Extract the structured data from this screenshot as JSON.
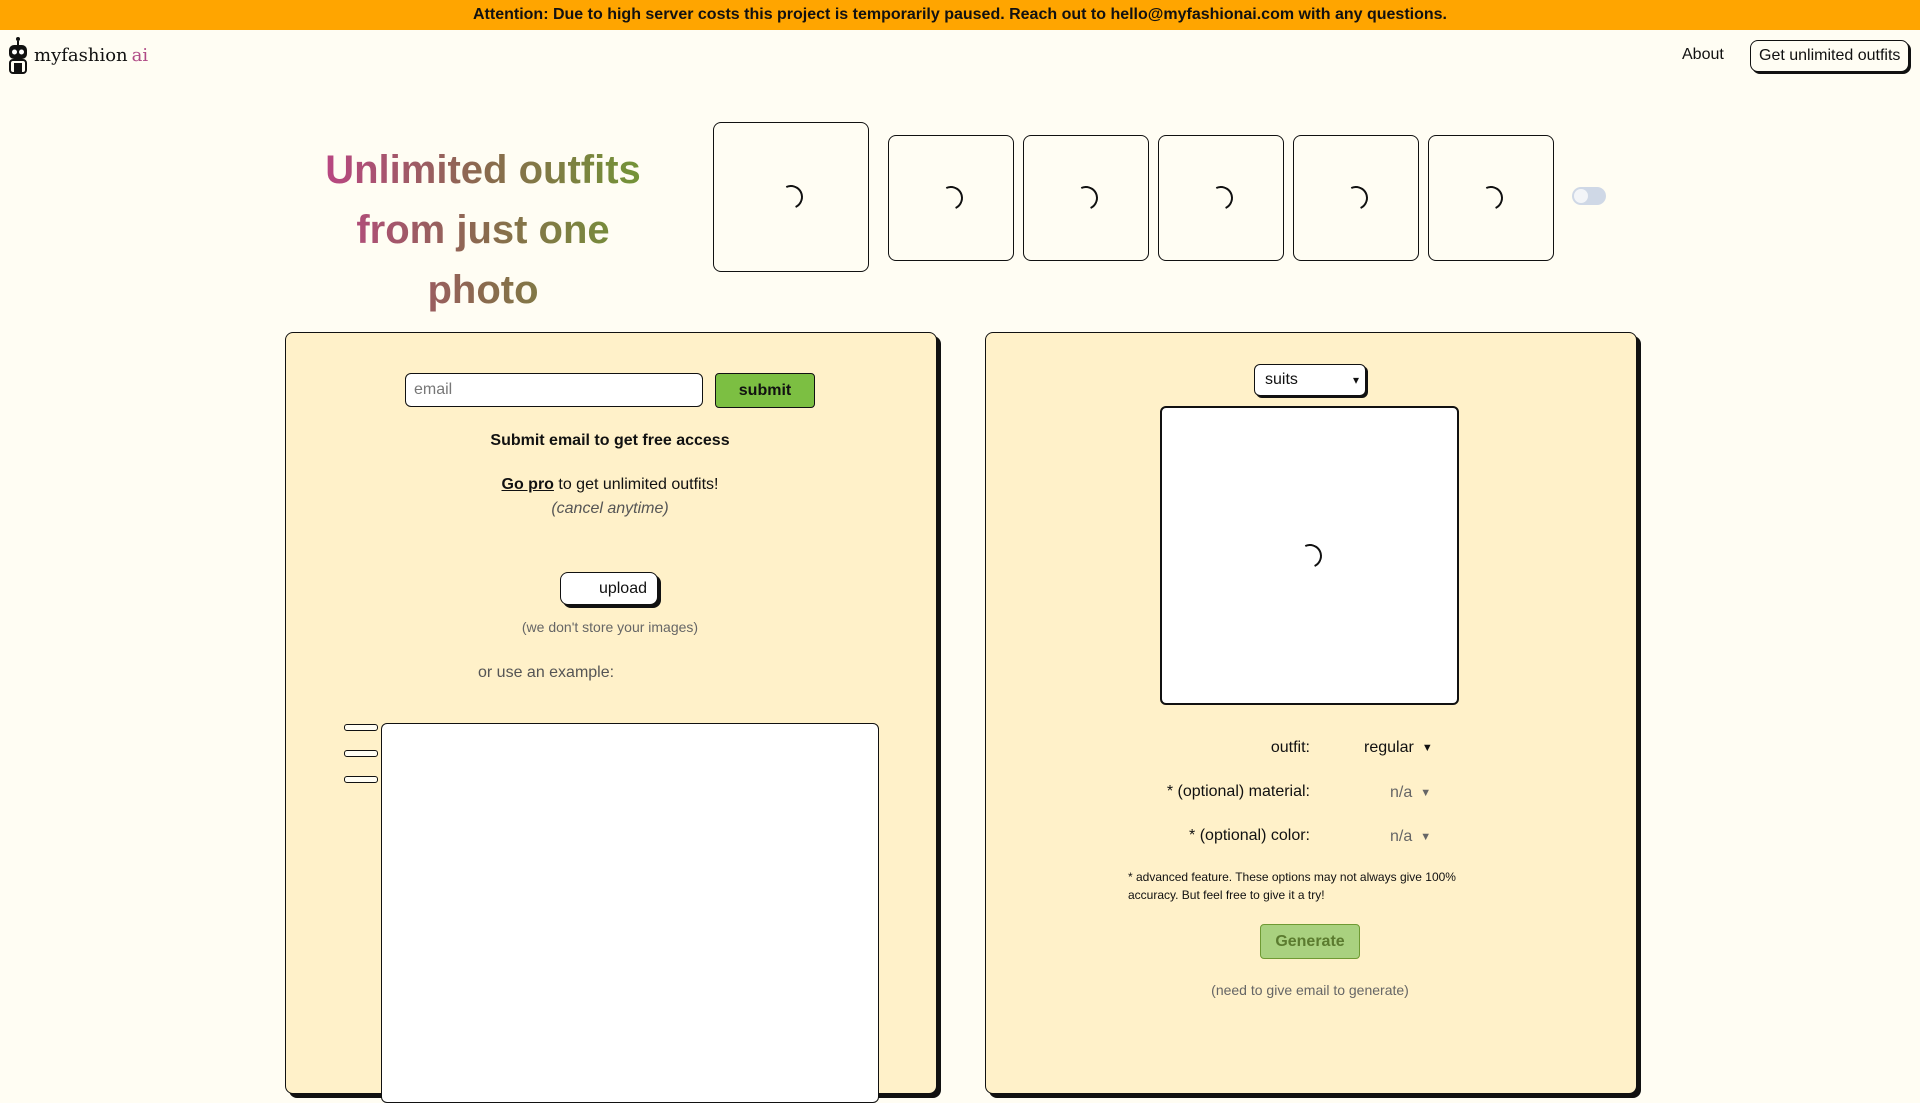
{
  "banner": {
    "text": "Attention: Due to high server costs this project is temporarily paused. Reach out to hello@myfashionai.com with any questions."
  },
  "header": {
    "logo_text": "myfashion",
    "logo_ai": "ai",
    "about_label": "About",
    "cta_label": "Get unlimited outfits"
  },
  "hero": {
    "line1": "Unlimited outfits",
    "line2": "from just one photo"
  },
  "left_panel": {
    "email_placeholder": "email",
    "submit_label": "submit",
    "email_prompt": "Submit email to get free access",
    "go_pro_link": "Go pro",
    "go_pro_rest": "to get unlimited outfits!",
    "cancel_note": "(cancel anytime)",
    "upload_label": "upload",
    "upload_note": "(we don't store your images)",
    "example_label": "or use an example:"
  },
  "right_panel": {
    "category_selected": "suits",
    "outfit_label": "outfit:",
    "outfit_value": "regular",
    "material_label": "* (optional) material:",
    "material_value": "n/a",
    "color_label": "* (optional) color:",
    "color_value": "n/a",
    "advanced_note": "* advanced feature. These options may not always give 100% accuracy. But feel free to give it a try!",
    "generate_label": "Generate",
    "generate_note": "(need to give email to generate)"
  }
}
